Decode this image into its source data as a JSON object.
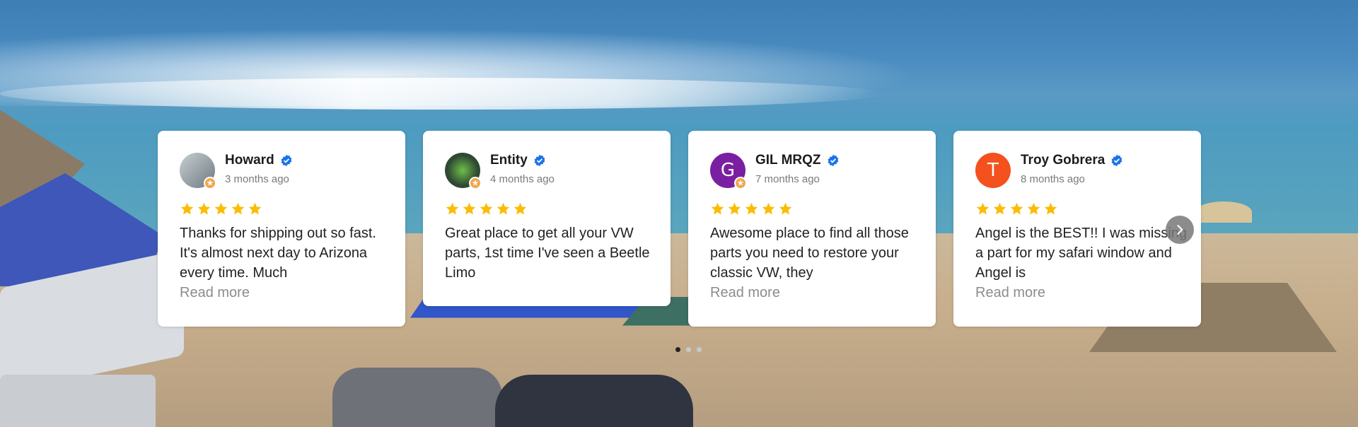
{
  "reviews": [
    {
      "name": "Howard",
      "date": "3 months ago",
      "rating": 5,
      "text": "Thanks for shipping out so fast. It's almost next day to Arizona every time. Much",
      "read_more": "Read more",
      "avatar_type": "photo",
      "avatar_color": "#7d8a8f"
    },
    {
      "name": "Entity",
      "date": "4 months ago",
      "rating": 5,
      "text": "Great place to get all your VW parts, 1st time I've seen a Beetle Limo",
      "read_more": "",
      "avatar_type": "photo",
      "avatar_color": "#2e4a32"
    },
    {
      "name": "GIL MRQZ",
      "date": "7 months ago",
      "rating": 5,
      "text": "Awesome place to find all those parts you need to restore your classic VW, they",
      "read_more": "Read more",
      "avatar_type": "letter",
      "avatar_letter": "G",
      "avatar_color": "#7b1fa2"
    },
    {
      "name": "Troy Gobrera",
      "date": "8 months ago",
      "rating": 5,
      "text": "Angel is the BEST!! I was missing a part for my safari window and Angel is",
      "read_more": "Read more",
      "avatar_type": "letter",
      "avatar_letter": "T",
      "avatar_color": "#f4511e"
    }
  ],
  "colors": {
    "star": "#fbbc04",
    "verified": "#1a73e8",
    "badge": "#f0a64d"
  },
  "pagination": {
    "count": 3,
    "active": 0
  },
  "icons": {
    "next": "chevron-right-icon",
    "verified": "verified-check-icon",
    "star": "star-icon"
  }
}
